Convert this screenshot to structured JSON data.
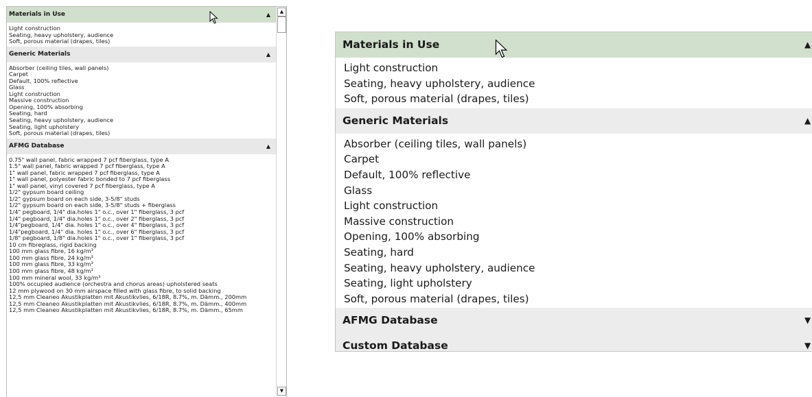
{
  "small_panel": {
    "sections": [
      {
        "title": "Materials in Use",
        "expanded": true,
        "selected": true,
        "items": [
          "Light construction",
          "Seating, heavy upholstery, audience",
          "Soft, porous material (drapes, tiles)"
        ]
      },
      {
        "title": "Generic Materials",
        "expanded": true,
        "selected": false,
        "items": [
          "Absorber (ceiling tiles, wall panels)",
          "Carpet",
          "Default, 100% reflective",
          "Glass",
          "Light construction",
          "Massive construction",
          "Opening, 100% absorbing",
          "Seating, hard",
          "Seating, heavy upholstery, audience",
          "Seating, light upholstery",
          "Soft, porous material (drapes, tiles)"
        ]
      },
      {
        "title": "AFMG Database",
        "expanded": true,
        "selected": false,
        "items": [
          "0.75\" wall panel, fabric wrapped 7 pcf fiberglass, type A",
          "1.5\" wall panel, fabric wrapped 7 pcf fiberglass, type A",
          "1\" wall panel, fabric wrapped 7 pcf fiberglass, type A",
          "1\" wall panel, polyester fabric bonded to 7 pcf fiberglass",
          "1\" wall panel, vinyl covered 7 pcf fiberglass, type A",
          "1/2\" gypsum board ceiling",
          "1/2\" gypsum board on each side, 3-5/8\" studs",
          "1/2\" gypsum board on each side, 3-5/8\" studs + fiberglass",
          "1/4\" pegboard, 1/4\" dia.holes 1\" o.c., over 1\" fiberglass, 3 pcf",
          "1/4\" pegboard, 1/4\" dia.holes 1\" o.c., over 2\" fiberglass, 3 pcf",
          "1/4\"pegboard, 1/4\" dia. holes 1\" o.c., over 4\" fiberglass, 3 pcf",
          "1/4\"pegboard, 1/4\" dia. holes 1\" o.c., over 6\" fiberglass, 3 pcf",
          "1/8\" pegboard, 1/8\" dia.holes 1\" o.c., over 1\" fiberglass, 3 pcf",
          "10 cm fibreglass, rigid backing",
          "100 mm glass fibre, 16 kg/m³",
          "100 mm glass fibre, 24 kg/m³",
          "100 mm glass fibre, 33 kg/m³",
          "100 mm glass fibre, 48 kg/m³",
          "100 mm mineral wool, 33 kg/m³",
          "100% occupied audience (orchestra and chorus areas) upholstered seats",
          "12 mm plywood on 30 mm airspace filled with glass fibre, to solid backing",
          "12,5 mm Cleaneo Akustikplatten mit Akustikvlies, 6/18R, 8.7%, m. Dämm., 200mm",
          "12,5 mm Cleaneo Akustikplatten mit Akustikvlies, 6/18R, 8.7%, m. Dämm., 400mm",
          "12,5 mm Cleaneo Akustikplatten mit Akustikvlies, 6/18R, 8.7%, m. Dämm., 65mm"
        ]
      }
    ],
    "scroll_up_icon": "triangle-up-icon",
    "scroll_down_icon": "triangle-down-icon",
    "section_expanded_icon": "triangle-up-icon"
  },
  "large_panel": {
    "sections": [
      {
        "title": "Materials in Use",
        "expanded": true,
        "selected": true,
        "items": [
          "Light construction",
          "Seating, heavy upholstery, audience",
          "Soft, porous material (drapes, tiles)"
        ]
      },
      {
        "title": "Generic Materials",
        "expanded": true,
        "selected": false,
        "items": [
          "Absorber (ceiling tiles, wall panels)",
          "Carpet",
          "Default, 100% reflective",
          "Glass",
          "Light construction",
          "Massive construction",
          "Opening, 100% absorbing",
          "Seating, hard",
          "Seating, heavy upholstery, audience",
          "Seating, light upholstery",
          "Soft, porous material (drapes, tiles)"
        ]
      },
      {
        "title": "AFMG Database",
        "expanded": false,
        "selected": false,
        "items": []
      },
      {
        "title": "Custom Database",
        "expanded": false,
        "selected": false,
        "items": []
      }
    ],
    "expanded_icon": "triangle-up-icon",
    "collapsed_icon": "triangle-down-icon"
  },
  "colors": {
    "selected_header": "#d1e0cc",
    "section_header": "#ececec",
    "text": "#1a1a1a"
  }
}
